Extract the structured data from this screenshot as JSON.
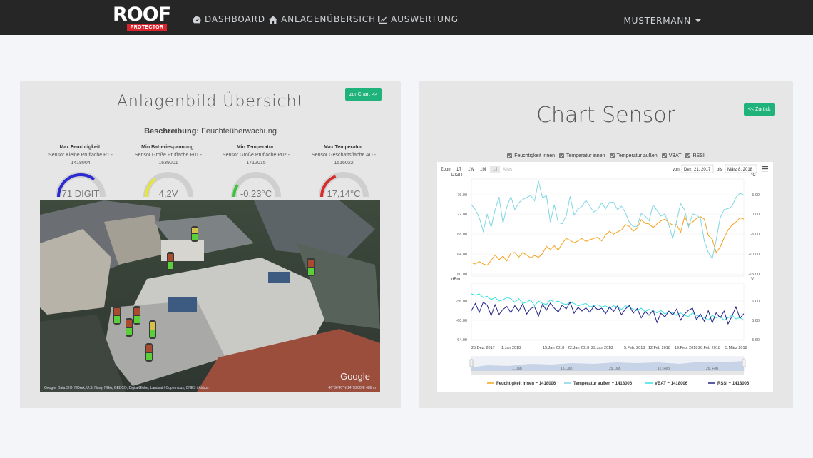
{
  "nav": {
    "logo_word": "ROOF",
    "logo_sub": "PROTECTOR",
    "items": [
      {
        "label": "DASHBOARD",
        "icon": "dashboard-icon"
      },
      {
        "label": "ANLAGENÜBERSICHT",
        "icon": "home-icon"
      },
      {
        "label": "AUSWERTUNG",
        "icon": "chart-icon"
      }
    ],
    "user": "MUSTERMANN"
  },
  "left": {
    "title": "Anlagenbild Übersicht",
    "button": "zur Chart >>",
    "desc_label": "Beschreibung:",
    "desc_value": "Feuchteüberwachung",
    "gauges": [
      {
        "title": "Max Feuchtigkeit:",
        "sub1": "Sensor Kleine Prüfläche P1 -",
        "sub2": "1418004",
        "value": "71 DIGIT",
        "color": "#2b2bd1",
        "fraction": 0.71
      },
      {
        "title": "Min Batteriespannung:",
        "sub1": "Sensor Große Prüfläche P01 -",
        "sub2": "1639001",
        "value": "4,2V",
        "color": "#e6e63a",
        "fraction": 0.3
      },
      {
        "title": "Min Temperatur:",
        "sub1": "Sensor Große Prüfläche P02 -",
        "sub2": "1712015",
        "value": "-0,23°C",
        "color": "#3cc43c",
        "fraction": 0.18
      },
      {
        "title": "Max Temperatur:",
        "sub1": "Sensor Geschäftsfläche AD -",
        "sub2": "1516022",
        "value": "17,14°C",
        "color": "#d82b2b",
        "fraction": 0.38
      }
    ],
    "map_attribution": "Google, Data SIO, NOAA, U.S. Navy, NGA, GEBCO, DigitalGlobe, Landsat / Copernicus, CNES / Airbus",
    "map_coords": "46°36'40\"N 14°18'06\"E  488 m",
    "map_brand": "Google"
  },
  "right": {
    "title": "Chart Sensor",
    "button": "<< Zurück",
    "checks": [
      "Feuchtigkeit innen",
      "Temperatur innen",
      "Temperatur außen",
      "VBAT",
      "RSSI"
    ],
    "zoom_label": "Zoom",
    "zoom_opts": [
      "1T",
      "1W",
      "1M",
      "1J",
      "Alles"
    ],
    "from_label": "von",
    "from_value": "Dez. 21, 2017",
    "to_label": "bis",
    "to_value": "März 8, 2018",
    "navigator_labels": [
      "1. Jan",
      "15. Jan",
      "29. Jan",
      "12. Feb",
      "26. Feb"
    ]
  },
  "chart_data": {
    "type": "line",
    "x_tick_labels": [
      "25.Dez. 2017",
      "1.Jan 2018",
      "15.Jan 2018",
      "22.Jan 2018",
      "29.Jan 2018",
      "5.Feb. 2018",
      "12.Feb 2018",
      "19.Feb. 2018",
      "26.Feb 2018",
      "5.März 2018"
    ],
    "panes": [
      {
        "left_axis": "DIGIT",
        "right_axis": "°C",
        "left_ticks": [
          76.0,
          72.0,
          68.0,
          64.0,
          60.0
        ],
        "right_ticks": [
          "5.00",
          "0.00",
          "-5.00",
          "-10.00",
          "-15.00"
        ],
        "left_ylim": [
          60,
          76
        ],
        "right_ylim": [
          -15,
          5
        ],
        "series": [
          {
            "name": "Feuchtigkeit innen ~ 1418006",
            "color": "#f5a21b",
            "axis": "left",
            "values": [
              62.2,
              62.0,
              62.4,
              62.0,
              61.8,
              62.6,
              63.5,
              62.7,
              63.3,
              62.5,
              63.8,
              63.9,
              63.1,
              63.9,
              63.5,
              63.0,
              63.4,
              63.1,
              63.7,
              64.9,
              64.4,
              65.0,
              64.3,
              65.4,
              66.2,
              65.9,
              65.5,
              65.8,
              66.2,
              65.7,
              66.0,
              66.2,
              66.4,
              65.8,
              66.8,
              67.4,
              66.9,
              67.3,
              67.6,
              68.5,
              68.2,
              67.4,
              67.9,
              69.3,
              68.7,
              68.6,
              68.0,
              68.6,
              69.1,
              69.4,
              68.8,
              68.4,
              68.5,
              67.2,
              69.8,
              68.5,
              68.9,
              69.5,
              69.8,
              69.4,
              66.7,
              66.1,
              63.9,
              64.8,
              66.3,
              67.6,
              68.4,
              68.9,
              69.6,
              69.4
            ]
          },
          {
            "name": "Temperatur außen ~ 1418006",
            "color": "#7fd6e3",
            "axis": "right",
            "values": [
              -0.3,
              -1.3,
              -3.0,
              -5.8,
              -2.3,
              -4.9,
              -1.4,
              1.3,
              -4.1,
              -0.7,
              1.4,
              -1.3,
              0.1,
              0.8,
              1.2,
              1.6,
              0.5,
              4.6,
              1.1,
              1.6,
              -3.9,
              -0.3,
              -4.0,
              -4.2,
              -2.6,
              1.4,
              -2.4,
              -1.2,
              -0.6,
              0.6,
              -0.6,
              -1.8,
              -1.3,
              0.1,
              -1.1,
              0.2,
              0.2,
              -1.3,
              -0.6,
              -1.9,
              -3.9,
              -4.8,
              -4.7,
              -2.1,
              -2.6,
              -3.6,
              -0.3,
              -1.5,
              -2.6,
              -2.2,
              -4.4,
              -7.3,
              -3.6,
              -0.1,
              -1.4,
              -4.9,
              -2.2,
              -2.4,
              -3.1,
              -7.8,
              -10.1,
              -11.4,
              -7.6,
              -3.0,
              -1.3,
              -1.1,
              -0.6,
              1.2,
              2.1,
              1.7
            ]
          }
        ]
      },
      {
        "left_axis": "dBm",
        "right_axis": "V",
        "left_ticks": [
          -56.0,
          -60.0,
          -64.0
        ],
        "right_ticks": [
          "6.00",
          "5.80",
          "5.60"
        ],
        "left_ylim": [
          -65.5,
          -52
        ],
        "right_ylim": [
          5.57,
          6.05
        ],
        "series": [
          {
            "name": "VBAT ~ 1418006",
            "color": "#35e0e0",
            "axis": "right",
            "values": [
              5.96,
              5.95,
              5.96,
              5.93,
              5.94,
              5.91,
              5.93,
              5.9,
              5.91,
              5.93,
              5.92,
              5.89,
              5.92,
              5.88,
              5.89,
              5.91,
              5.86,
              5.9,
              5.88,
              5.87,
              5.91,
              5.89,
              5.9,
              5.88,
              5.87,
              5.89,
              5.88,
              5.86,
              5.87,
              5.88,
              5.85,
              5.86,
              5.87,
              5.85,
              5.86,
              5.84,
              5.86,
              5.85,
              5.83,
              5.86,
              5.85,
              5.83,
              5.82,
              5.84,
              5.81,
              5.83,
              5.82,
              5.8,
              5.82,
              5.79,
              5.81,
              5.8,
              5.78,
              5.8,
              5.78,
              5.77,
              5.8,
              5.78,
              5.77,
              5.76,
              5.74,
              5.78,
              5.76,
              5.77,
              5.74,
              5.76,
              5.78,
              5.75,
              5.76,
              5.74
            ]
          },
          {
            "name": "RSSI ~ 1418006",
            "color": "#23238a",
            "axis": "left",
            "values": [
              -58.5,
              -56.8,
              -58.9,
              -56.5,
              -57.2,
              -59.7,
              -57.1,
              -59.4,
              -58.2,
              -57.5,
              -59.0,
              -57.3,
              -58.6,
              -56.9,
              -59.3,
              -58.0,
              -57.6,
              -59.8,
              -57.0,
              -58.4,
              -56.7,
              -57.9,
              -58.8,
              -57.2,
              -58.1,
              -56.5,
              -59.1,
              -57.7,
              -58.6,
              -57.8,
              -58.9,
              -57.4,
              -58.3,
              -57.9,
              -59.2,
              -57.6,
              -58.7,
              -57.4,
              -59.5,
              -58.1,
              -57.3,
              -59.1,
              -58.0,
              -60.2,
              -58.7,
              -59.6,
              -58.4,
              -61.3,
              -59.1,
              -60.0,
              -58.6,
              -59.5,
              -58.1,
              -60.7,
              -59.3,
              -58.4,
              -57.9,
              -60.6,
              -59.3,
              -61.0,
              -58.5,
              -61.4,
              -59.0,
              -60.2,
              -58.6,
              -61.6,
              -59.8,
              -57.6,
              -60.3,
              -59.2
            ]
          }
        ]
      }
    ],
    "legend": [
      "Feuchtigkeit innen ~ 1418006",
      "Temperatur außen ~ 1418006",
      "VBAT ~ 1418006",
      "RSSI ~ 1418006"
    ],
    "legend_colors": [
      "#f5a21b",
      "#7fd6e3",
      "#35e0e0",
      "#23238a"
    ]
  }
}
